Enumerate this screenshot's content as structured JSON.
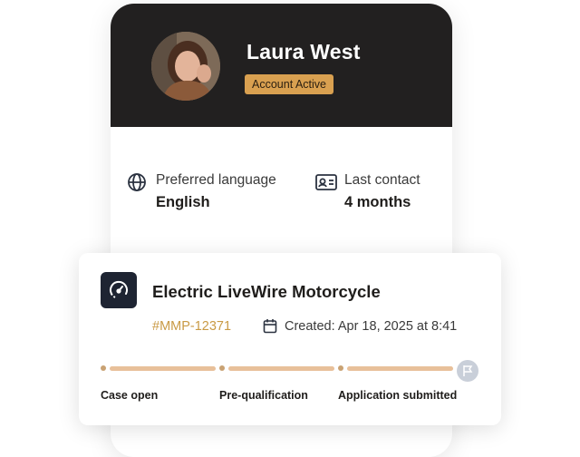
{
  "profile": {
    "name": "Laura West",
    "status": "Account Active"
  },
  "info": {
    "language": {
      "label": "Preferred language",
      "value": "English",
      "icon": "globe-icon"
    },
    "contact": {
      "label": "Last contact",
      "value": "4 months",
      "icon": "contact-card-icon"
    }
  },
  "case": {
    "title": "Electric LiveWire Motorcycle",
    "id": "#MMP-12371",
    "created": "Created: Apr 18, 2025 at 8:41",
    "icon": "speedometer-icon",
    "steps": [
      "Case open",
      "Pre-qualification",
      "Application submitted"
    ],
    "final_icon": "flag-icon"
  },
  "colors": {
    "header_bg": "#222020",
    "badge_bg": "#d9a050",
    "accent_text": "#c99a45",
    "progress": "#e8c09a",
    "case_icon_bg": "#1e2432"
  }
}
